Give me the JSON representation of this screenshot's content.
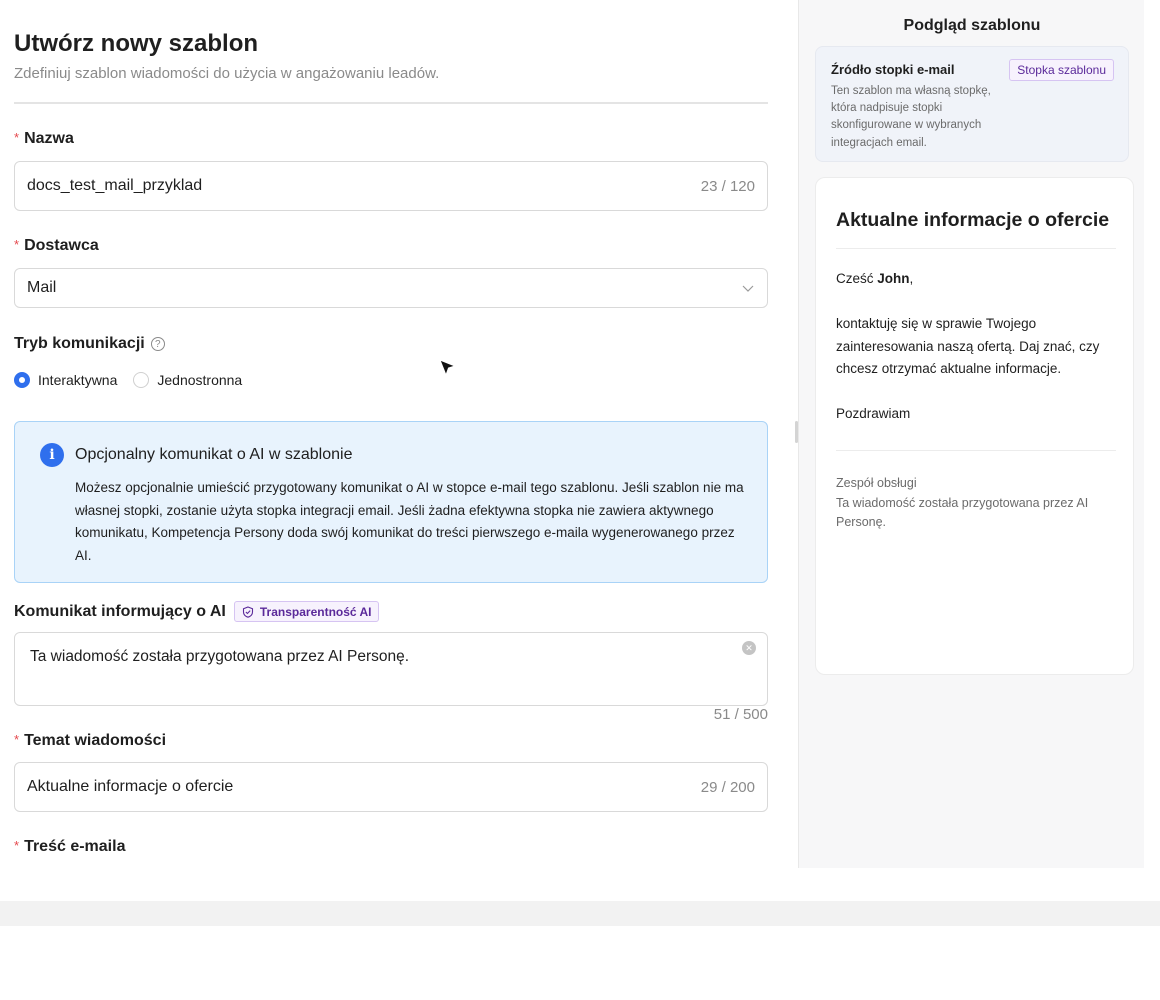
{
  "header": {
    "title": "Utwórz nowy szablon",
    "subtitle": "Zdefiniuj szablon wiadomości do użycia w angażowaniu leadów."
  },
  "fields": {
    "name": {
      "label": "Nazwa",
      "value": "docs_test_mail_przyklad",
      "count": "23 / 120"
    },
    "provider": {
      "label": "Dostawca",
      "value": "Mail"
    },
    "mode": {
      "label": "Tryb komunikacji",
      "help": "?",
      "options": [
        {
          "label": "Interaktywna",
          "checked": true
        },
        {
          "label": "Jednostronna",
          "checked": false
        }
      ]
    },
    "ai_notice": {
      "label": "Komunikat informujący o AI",
      "badge": "Transparentność AI",
      "value": "Ta wiadomość została przygotowana przez AI Personę.",
      "count": "51 / 500"
    },
    "subject": {
      "label": "Temat wiadomości",
      "value": "Aktualne informacje o ofercie",
      "count": "29 / 200"
    },
    "body": {
      "label": "Treść e-maila"
    }
  },
  "info_box": {
    "icon": "i",
    "title": "Opcjonalny komunikat o AI w szablonie",
    "text": "Możesz opcjonalnie umieścić przygotowany komunikat o AI w stopce e-mail tego szablonu. Jeśli szablon nie ma własnej stopki, zostanie użyta stopka integracji email. Jeśli żadna efektywna stopka nie zawiera aktywnego komunikatu, Kompetencja Persony doda swój komunikat do treści pierwszego e-maila wygenerowanego przez AI."
  },
  "preview": {
    "title": "Podgląd szablonu",
    "footer_source": {
      "title": "Źródło stopki e-mail",
      "text": "Ten szablon ma własną stopkę, która nadpisuje stopki skonfigurowane w wybranych integracjach email.",
      "badge": "Stopka szablonu"
    },
    "email": {
      "subject": "Aktualne informacje o ofercie",
      "greeting_prefix": "Cześć ",
      "greeting_name": "John",
      "greeting_suffix": ",",
      "paragraph": "kontaktuję się w sprawie Twojego zainteresowania naszą ofertą. Daj znać, czy chcesz otrzymać aktualne informacje.",
      "closing": "Pozdrawiam",
      "footer_team": "Zespół obsługi",
      "footer_ai": "Ta wiadomość została przygotowana przez AI Personę."
    }
  },
  "colors": {
    "accent": "#2f6fed",
    "required": "#e5484d",
    "info_bg": "#e8f3fd",
    "badge_purple": "#5b2a9a"
  }
}
